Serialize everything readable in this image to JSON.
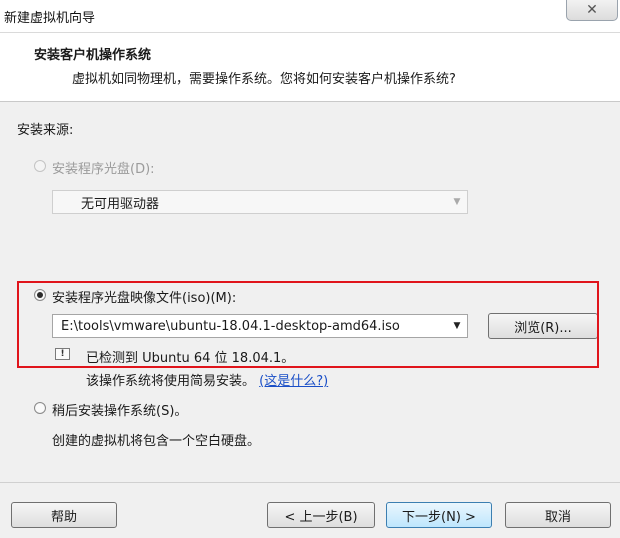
{
  "window": {
    "title": "新建虚拟机向导",
    "close_glyph": "✕"
  },
  "header": {
    "title": "安装客户机操作系统",
    "subtitle": "虚拟机如同物理机，需要操作系统。您将如何安装客户机操作系统?"
  },
  "install_source": {
    "label": "安装来源:",
    "disc_option": {
      "label": "安装程序光盘(D):",
      "selected": false,
      "enabled": false
    },
    "disc_combo": {
      "value": "无可用驱动器",
      "enabled": false
    },
    "iso_option": {
      "label": "安装程序光盘映像文件(iso)(M):",
      "selected": true
    },
    "iso_combo": {
      "value": "E:\\tools\\vmware\\ubuntu-18.04.1-desktop-amd64.iso"
    },
    "browse_label": "浏览(R)...",
    "detected_text": "已检测到 Ubuntu 64 位 18.04.1。",
    "easy_install_text": "该操作系统将使用简易安装。",
    "whats_this_link": "(这是什么?)",
    "later_option": {
      "label": "稍后安装操作系统(S)。",
      "selected": false
    },
    "later_desc": "创建的虚拟机将包含一个空白硬盘。"
  },
  "footer": {
    "help_label": "帮助",
    "back_label": "< 上一步(B)",
    "next_label": "下一步(N) >",
    "cancel_label": "取消"
  },
  "icons": {
    "info": "info-icon",
    "dropdown": "dropdown-arrow-icon"
  },
  "colors": {
    "highlight": "#e0141b",
    "link": "#1a4fc7",
    "primary_button": "#bee6fd"
  }
}
